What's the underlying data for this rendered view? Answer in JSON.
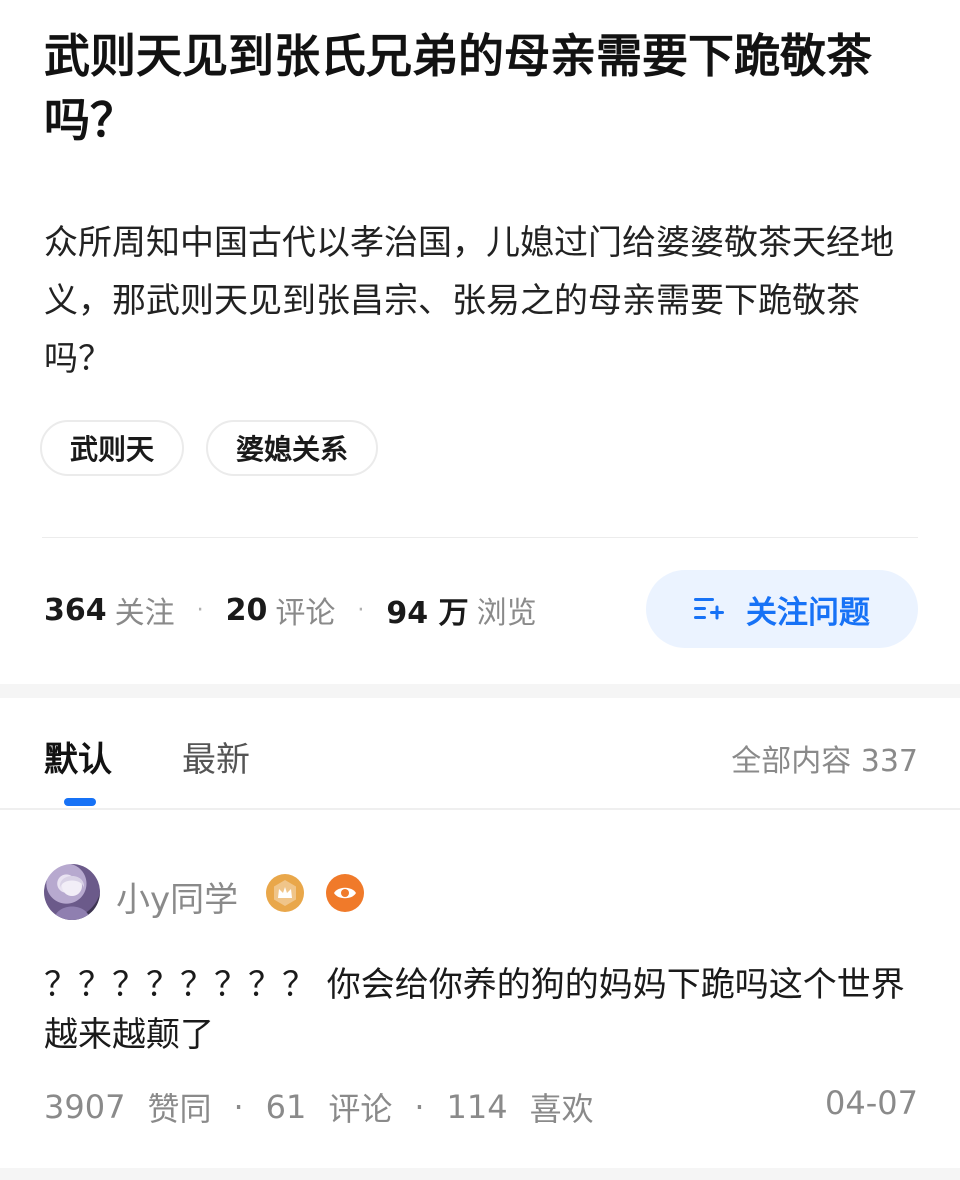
{
  "question": {
    "title": "武则天见到张氏兄弟的母亲需要下跪敬茶吗？",
    "description": "众所周知中国古代以孝治国，儿媳过门给婆婆敬茶天经地义，那武则天见到张昌宗、张易之的母亲需要下跪敬茶吗？",
    "tags": [
      "武则天",
      "婆媳关系"
    ],
    "stats": {
      "followers": "364",
      "followers_label": "关注",
      "comments": "20",
      "comments_label": "评论",
      "views": "94 万",
      "views_label": "浏览"
    },
    "follow_button": "关注问题"
  },
  "tabs": {
    "default": "默认",
    "latest": "最新",
    "total_label": "全部内容 337"
  },
  "answer": {
    "author": "小y同学",
    "text": "？？？？？？？？ 你会给你养的狗的妈妈下跪吗这个世界越来越颠了",
    "likes": "3907",
    "likes_label": "赞同",
    "comments": "61",
    "comments_label": "评论",
    "favorites": "114",
    "favorites_label": "喜欢",
    "date": "04-07"
  },
  "colors": {
    "accent": "#1772f6",
    "follow_bg": "#ebf3ff",
    "badge_crown": "#e9a74a",
    "badge_eye": "#f07a2a"
  },
  "icons": {
    "follow": "follow-add-icon",
    "badge_1": "crown-badge-icon",
    "badge_2": "eye-badge-icon"
  }
}
